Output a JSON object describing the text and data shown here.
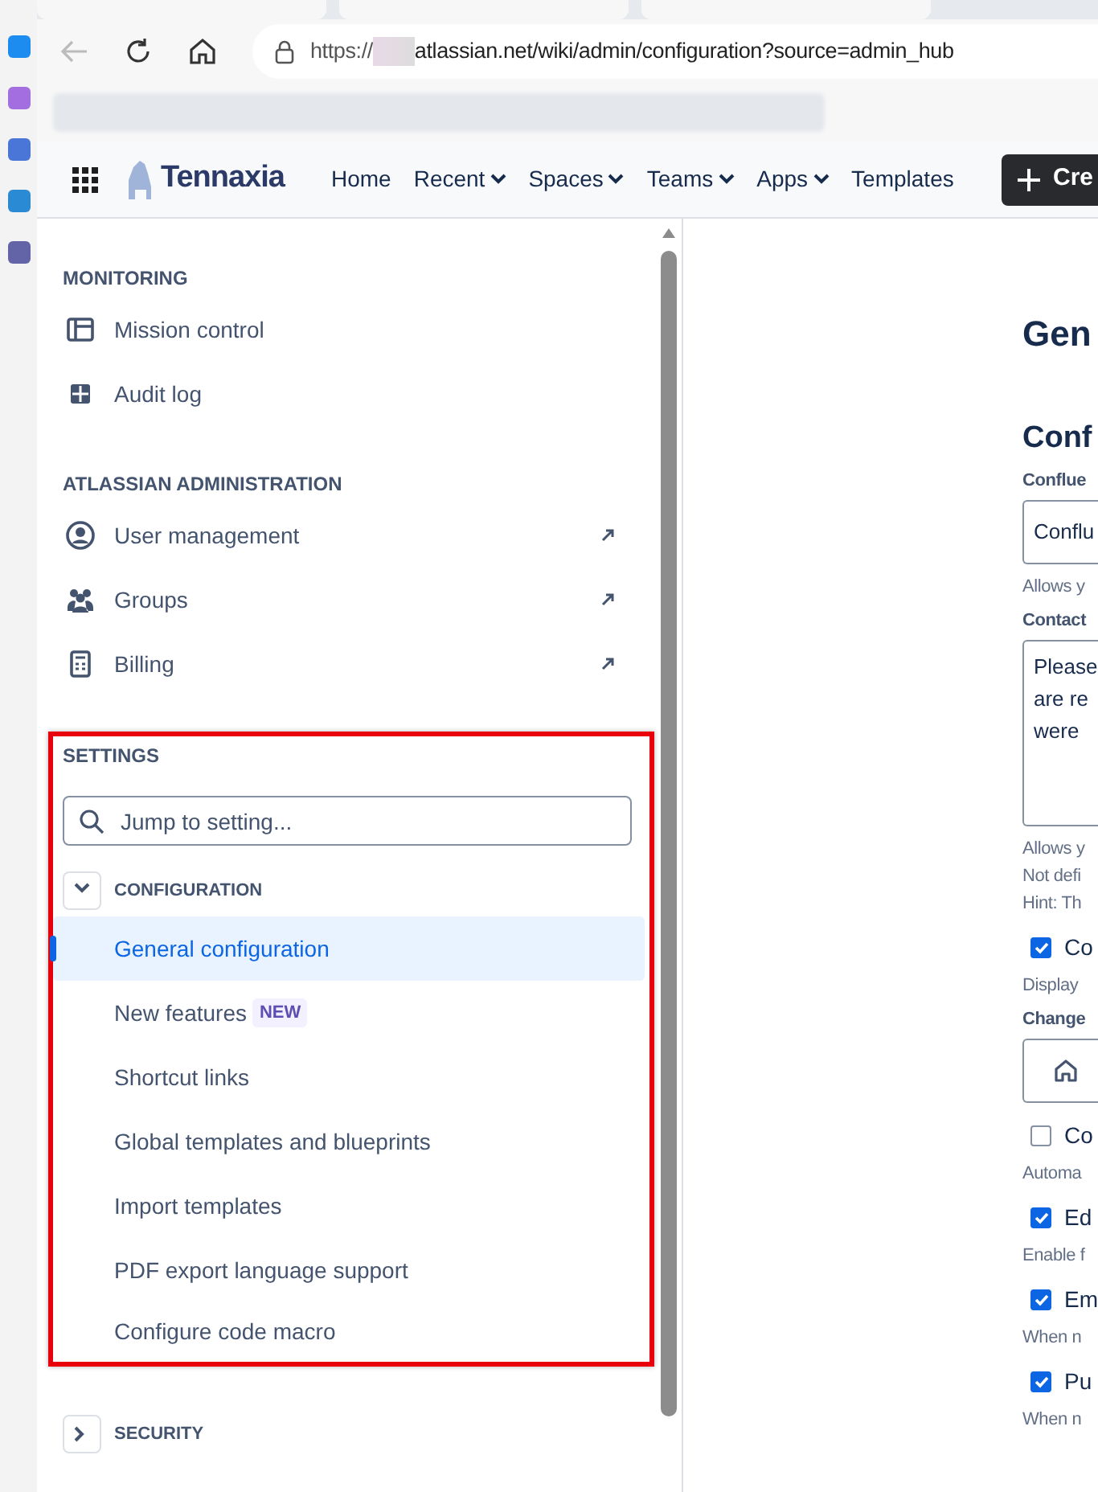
{
  "browser": {
    "url": {
      "scheme": "https://",
      "rest": "atlassian.net/wiki/admin/configuration?source=admin_hub"
    }
  },
  "nav": {
    "logo": "Tennaxia",
    "items": [
      {
        "label": "Home",
        "dropdown": false
      },
      {
        "label": "Recent",
        "dropdown": true
      },
      {
        "label": "Spaces",
        "dropdown": true
      },
      {
        "label": "Teams",
        "dropdown": true
      },
      {
        "label": "Apps",
        "dropdown": true
      },
      {
        "label": "Templates",
        "dropdown": false
      }
    ],
    "create": "Cre"
  },
  "sidebar": {
    "sections": [
      {
        "heading": "MONITORING",
        "items": [
          {
            "label": "Mission control",
            "kind": "panel",
            "external": false
          },
          {
            "label": "Audit log",
            "kind": "grid",
            "external": false
          }
        ]
      },
      {
        "heading": "ATLASSIAN ADMINISTRATION",
        "items": [
          {
            "label": "User management",
            "kind": "user",
            "external": true
          },
          {
            "label": "Groups",
            "kind": "groups",
            "external": true
          },
          {
            "label": "Billing",
            "kind": "calculator",
            "external": true
          }
        ]
      }
    ],
    "settings": {
      "heading": "SETTINGS",
      "search_placeholder": "Jump to setting...",
      "groups": [
        {
          "label": "CONFIGURATION",
          "expanded": true,
          "items": [
            {
              "label": "General configuration",
              "selected": true
            },
            {
              "label": "New features",
              "selected": false,
              "badge": "NEW"
            },
            {
              "label": "Shortcut links",
              "selected": false
            },
            {
              "label": "Global templates and blueprints",
              "selected": false
            },
            {
              "label": "Import templates",
              "selected": false
            },
            {
              "label": "PDF export language support",
              "selected": false
            },
            {
              "label": "Configure code macro",
              "selected": false
            }
          ]
        },
        {
          "label": "SECURITY",
          "expanded": false
        }
      ]
    }
  },
  "content": {
    "title": "Gen",
    "section": "Conf",
    "items": [
      {
        "kind": "label",
        "text": "Conflue"
      },
      {
        "kind": "input",
        "text": "Conflu"
      },
      {
        "kind": "help",
        "text": "Allows y"
      },
      {
        "kind": "label",
        "text": "Contact"
      },
      {
        "kind": "textarea",
        "lines": [
          "Please",
          "are re",
          "were"
        ]
      },
      {
        "kind": "help",
        "text": "Allows y"
      },
      {
        "kind": "help2",
        "text": "Not defi"
      },
      {
        "kind": "help2",
        "text": "Hint: Th"
      },
      {
        "kind": "checkbox",
        "text": "Co",
        "checked": true
      },
      {
        "kind": "help",
        "text": "Display"
      },
      {
        "kind": "label",
        "text": "Change"
      },
      {
        "kind": "icon-input"
      },
      {
        "kind": "checkbox",
        "text": "Co",
        "checked": false
      },
      {
        "kind": "help",
        "text": "Automa"
      },
      {
        "kind": "checkbox",
        "text": "Ed",
        "checked": true
      },
      {
        "kind": "help",
        "text": "Enable f"
      },
      {
        "kind": "checkbox",
        "text": "Em",
        "checked": true
      },
      {
        "kind": "help",
        "text": "When n"
      },
      {
        "kind": "checkbox",
        "text": "Pu",
        "checked": true
      },
      {
        "kind": "help",
        "text": "When n"
      }
    ]
  }
}
